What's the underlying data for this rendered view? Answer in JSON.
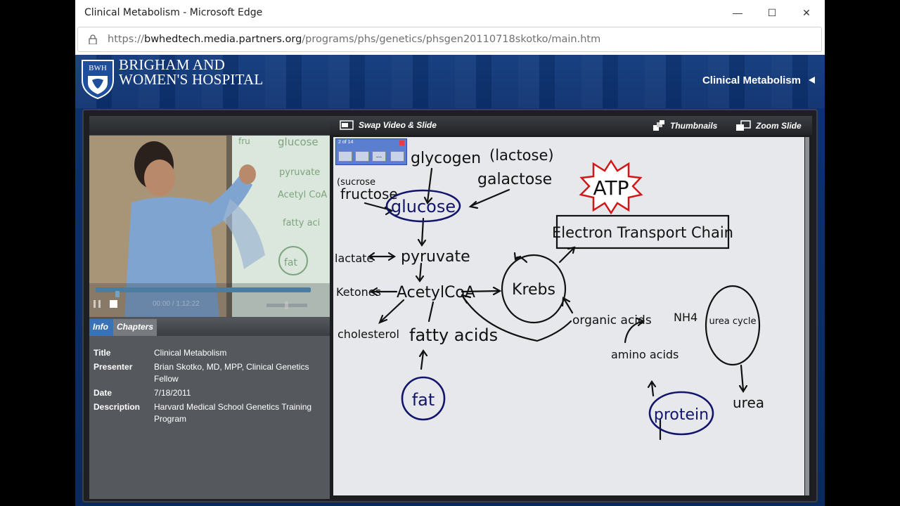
{
  "window": {
    "title": "Clinical Metabolism - Microsoft Edge",
    "controls": {
      "minimize": "—",
      "maximize": "☐",
      "close": "✕"
    }
  },
  "address": {
    "scheme": "https://",
    "host": "bwhedtech.media.partners.org",
    "path": "/programs/phs/genetics/phsgen20110718skotko/main.htm"
  },
  "header": {
    "logo_abbr": "BWH",
    "logo_line1": "BRIGHAM AND",
    "logo_line2": "WOMEN'S HOSPITAL",
    "course_title": "Clinical Metabolism"
  },
  "toolbar": {
    "swap_label": "Swap Video & Slide",
    "thumbnails_label": "Thumbnails",
    "zoom_label": "Zoom Slide"
  },
  "slide_toolbar": {
    "counter": "2 of 14",
    "more": "..."
  },
  "video": {
    "time": "00:00 / 1:12:22",
    "progress": 0.09,
    "volume": 0.5,
    "board_words": [
      "fru",
      "glucose",
      "pyruvate",
      "Acetyl CoA",
      "fatty aci",
      "fat"
    ]
  },
  "tabs": {
    "info": "Info",
    "chapters": "Chapters"
  },
  "info": {
    "title_k": "Title",
    "title_v": "Clinical Metabolism",
    "presenter_k": "Presenter",
    "presenter_v": "Brian Skotko, MD, MPP, Clinical Genetics Fellow",
    "date_k": "Date",
    "date_v": "7/18/2011",
    "description_k": "Description",
    "description_v": "Harvard Medical School Genetics Training Program"
  },
  "diagram": {
    "glycogen": "glycogen",
    "lactose": "(lactose)",
    "galactose": "galactose",
    "sucrose": "(sucrose",
    "fructose": "fructose",
    "glucose": "glucose",
    "atp": "ATP",
    "etc": "Electron Transport Chain",
    "lactate": "lactate",
    "pyruvate": "pyruvate",
    "krebs": "Krebs",
    "ketones": "Ketones",
    "acetylcoa": "AcetylCoA",
    "organic_acids": "organic acids",
    "nh4": "NH4",
    "urea_cycle": "urea cycle",
    "cholesterol": "cholesterol",
    "fatty_acids": "fatty acids",
    "amino_acids": "amino acids",
    "fat": "fat",
    "protein": "protein",
    "urea": "urea"
  }
}
